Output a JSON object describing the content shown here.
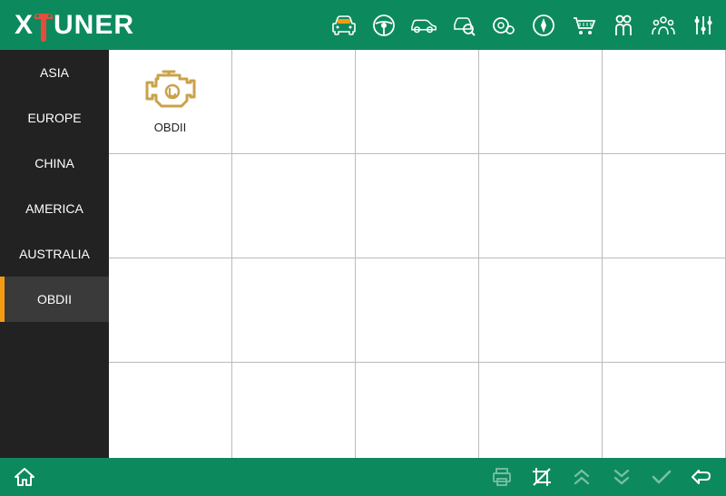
{
  "colors": {
    "brand_green": "#0c8a5e",
    "accent_orange": "#f39c12",
    "icon_gold": "#c9a24a"
  },
  "logo": {
    "text_left": "X",
    "text_right": "UNER"
  },
  "header_icons": [
    {
      "name": "car-front-icon"
    },
    {
      "name": "steering-wheel-icon"
    },
    {
      "name": "car-side-icon"
    },
    {
      "name": "car-search-icon"
    },
    {
      "name": "tire-settings-icon"
    },
    {
      "name": "compass-icon"
    },
    {
      "name": "shopping-cart-icon"
    },
    {
      "name": "people-icon"
    },
    {
      "name": "group-icon"
    },
    {
      "name": "sliders-icon"
    }
  ],
  "sidebar": {
    "items": [
      {
        "label": "ASIA",
        "active": false
      },
      {
        "label": "EUROPE",
        "active": false
      },
      {
        "label": "CHINA",
        "active": false
      },
      {
        "label": "AMERICA",
        "active": false
      },
      {
        "label": "AUSTRALIA",
        "active": false
      },
      {
        "label": "OBDII",
        "active": true
      }
    ]
  },
  "grid": {
    "columns": 5,
    "rows": 4,
    "items": [
      {
        "label": "OBDII",
        "icon": "engine-icon"
      }
    ]
  },
  "footer": {
    "left": [
      {
        "name": "home-icon"
      }
    ],
    "right": [
      {
        "name": "print-icon",
        "disabled": true
      },
      {
        "name": "crop-icon",
        "disabled": false
      },
      {
        "name": "collapse-up-icon",
        "disabled": true
      },
      {
        "name": "expand-down-icon",
        "disabled": true
      },
      {
        "name": "check-icon",
        "disabled": true
      },
      {
        "name": "back-icon",
        "disabled": false
      }
    ]
  }
}
